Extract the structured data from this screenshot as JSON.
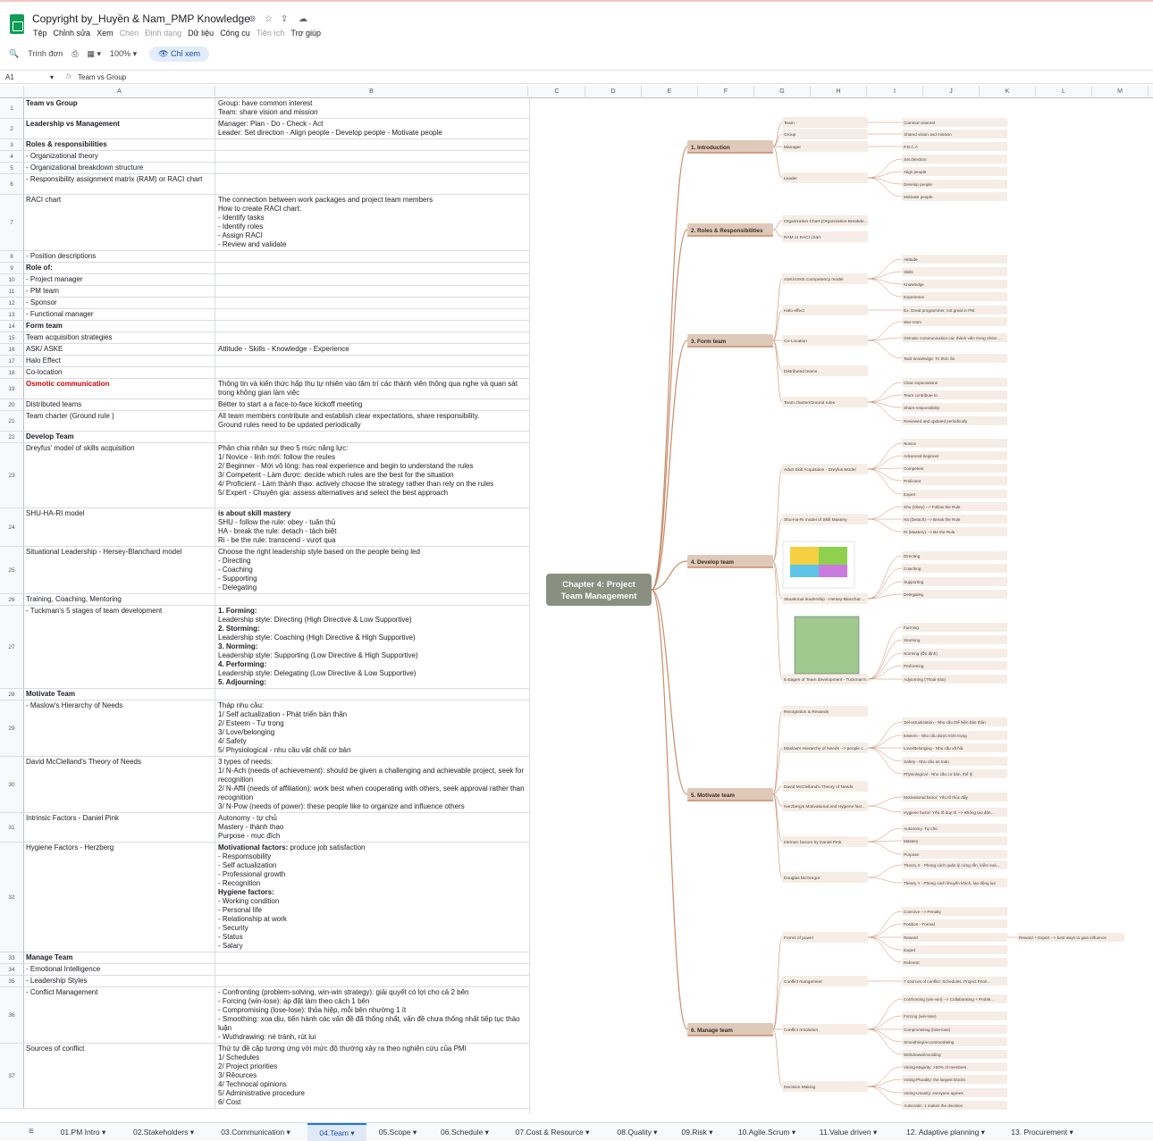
{
  "title": "Copyright by_Huyền & Nam_PMP Knowledge",
  "menus": [
    "Tệp",
    "Chỉnh sửa",
    "Xem",
    "Chèn",
    "Định dạng",
    "Dữ liệu",
    "Công cụ",
    "Tiện ích",
    "Trợ giúp"
  ],
  "toolbar": {
    "search": "Trình đơn",
    "zoom": "100%",
    "viewonly": "Chỉ xem"
  },
  "formula": {
    "cell": "A1",
    "value": "Team vs Group"
  },
  "columns": [
    "A",
    "B",
    "C",
    "D",
    "E",
    "F",
    "G",
    "H",
    "I",
    "J",
    "K",
    "L",
    "M"
  ],
  "rows": [
    {
      "n": "1",
      "a": "Team vs Group",
      "ab": true,
      "b": "Group: have common interest\nTeam: share vision and mission"
    },
    {
      "n": "2",
      "a": "Leadership vs Management",
      "ab": true,
      "b": "Manager: Plan - Do - Check - Act\nLeader: Set direction - Align people - Develop people - Motivate people"
    },
    {
      "n": "3",
      "a": "Roles & responsibilities",
      "ab": true,
      "b": ""
    },
    {
      "n": "4",
      "a": "- Organizational theory",
      "b": ""
    },
    {
      "n": "5",
      "a": "- Organizational breakdown structure",
      "b": ""
    },
    {
      "n": "6",
      "a": "- Responsibility assignment matrix (RAM) or RACI chart",
      "b": ""
    },
    {
      "n": "7",
      "a": "RACI chart",
      "b": "The connection between work packages and project team members\nHow to create RACI chart:\n- Identify tasks\n- Identify roles\n- Assign RACI\n- Review and validate"
    },
    {
      "n": "8",
      "a": "- Position descriptions",
      "b": ""
    },
    {
      "n": "9",
      "a": "Role of:",
      "ab": true,
      "b": ""
    },
    {
      "n": "10",
      "a": "- Project manager",
      "b": ""
    },
    {
      "n": "11",
      "a": "- PM team",
      "b": ""
    },
    {
      "n": "12",
      "a": "- Sponsor",
      "b": ""
    },
    {
      "n": "13",
      "a": "- Functional manager",
      "b": ""
    },
    {
      "n": "14",
      "a": "Form team",
      "ab": true,
      "b": ""
    },
    {
      "n": "15",
      "a": "Team acquisition strategies",
      "b": ""
    },
    {
      "n": "16",
      "a": "ASK/ ASKE",
      "b": "Attitude - Skills - Knowledge - Experience"
    },
    {
      "n": "17",
      "a": "Halo Effect",
      "b": ""
    },
    {
      "n": "18",
      "a": "Co-location",
      "b": ""
    },
    {
      "n": "19",
      "a": "Osmotic communication",
      "ab": true,
      "ared": true,
      "b": "Thông tin và kiến thức hấp thụ tự nhiên vào tâm trí các thành viên thông qua nghe và quan sát trong không gian làm việc"
    },
    {
      "n": "20",
      "a": "Distributed teams",
      "b": "Better to start a a face-to-face kickoff meeting"
    },
    {
      "n": "21",
      "a": "Team charter (Ground rule )",
      "b": "All team members contribute and establish clear expectations, share responsibility.\nGround rules need to be updated periodically"
    },
    {
      "n": "22",
      "a": "Develop Team",
      "ab": true,
      "b": ""
    },
    {
      "n": "23",
      "a": "Dreyfus' model of skills acquisition",
      "b": "Phân chia nhân sự theo 5 mức năng lực:\n1/ Novice - linh mới: follow the reules\n2/ Beginner - Mới vô lòng: has real experience and begin to understand the rules\n3/ Competent - Làm được: decide which rules are the best for the situation\n4/ Proficient - Làm thành thạo: actively choose the strategy rather than rely on the rules\n5/ Expert - Chuyên gia: assess alternatives and select the best approach"
    },
    {
      "n": "24",
      "a": "SHU-HA-RI model",
      "b": "is about skill mastery\nSHU - follow the rule: obey - tuân thủ\nHA - break the rule: detach - tách biệt\nRi - be the rule: transcend - vượt qua"
    },
    {
      "n": "25",
      "a": "Situational Leadership - Hersey-Blanchard model",
      "b": "Choose the right leadership style based on the people being led\n- Directing\n- Coaching\n- Supporting\n- Delegating"
    },
    {
      "n": "26",
      "a": "Training, Coaching, Mentoring",
      "b": ""
    },
    {
      "n": "27",
      "a": "- Tuckman's 5 stages of team development",
      "b": "1. Forming:\nLeadership style: Directing (High Directive & Low Supportive)\n2. Storming:\nLeadership style: Coaching (High Directive & High Supportive)\n3. Norming:\nLeadership style: Supporting (Low Directive & High Supportive)\n4. Performing:\nLeadership style: Delegating (Low Directive & Low Supportive)\n5. Adjourning:"
    },
    {
      "n": "28",
      "a": "Motivate Team",
      "ab": true,
      "b": ""
    },
    {
      "n": "29",
      "a": "- Maslow's Hierarchy of Needs",
      "b": "Tháp nhu cầu:\n1/ Self actualization - Phát triển bản thân\n2/ Esteem - Tự trọng\n3/ Love/belonging\n4/ Safety\n5/ Physiological - nhu cầu vật chất cơ bản"
    },
    {
      "n": "30",
      "a": "David McClelland's Theory of Needs",
      "b": "3 types of needs:\n1/ N-Ach (needs of achievement): should be given a challenging and achievable project, seek for recognition\n2/ N-Affil (needs of affiliation): work best when cooperating with others, seek approval rather than recognition\n3/ N-Pow (needs of power): these people like to organize and influence others"
    },
    {
      "n": "31",
      "a": "Intrinsic Factors - Daniel Pink",
      "b": "Autonomy - tự chủ\nMastery - thành thạo\nPurpose - mục đích"
    },
    {
      "n": "32",
      "a": "Hygiene Factors - Herzberg",
      "b": "Motivational factors: produce job satisfaction\n- Respomsobility\n- Self actualization\n- Professional growth\n- Recognition\nHygiene factors:\n- Working condition\n- Personal life\n- Relationship at work\n- Security\n- Status\n- Salary"
    },
    {
      "n": "33",
      "a": "Manage Team",
      "ab": true,
      "b": ""
    },
    {
      "n": "34",
      "a": "- Emotional Intelligence",
      "b": ""
    },
    {
      "n": "35",
      "a": "- Leadership Styles",
      "b": ""
    },
    {
      "n": "36",
      "a": "- Conflict Management",
      "b": "- Confronting (problem-solving, win-win strategy): giải quyết có lợi cho cả 2 bên\n- Forcing (win-lose): áp đặt làm theo cách 1 bên\n- Compromising (lose-lose): thỏa hiệp, mỗi bên nhường 1 ít\n- Smoothing: xoa dịu, tiến hành các vấn đề đã thống nhất, vấn đề chưa thống nhất tiếp tục thảo luận\n- Wuthdrawing: né tránh, rút lui"
    },
    {
      "n": "37",
      "a": "Sources of conflict",
      "b": "Thứ tự đề cập tương ứng với mức độ thường xảy ra theo nghiên cứu của PMI\n1/ Schedules\n2/ Project priorities\n3/ Rêources\n4/ Technocal opinions\n5/ Administrative procedure\n6/ Cost\n7/ Personality"
    }
  ],
  "mindmap": {
    "root": "Chapter 4: Project Team Management",
    "branches": [
      {
        "label": "1. Introduction",
        "mids": [
          {
            "label": "Team",
            "leaves": [
              "Common interest"
            ]
          },
          {
            "label": "Group",
            "leaves": [
              "Shared vision and mission"
            ]
          },
          {
            "label": "Manager",
            "leaves": [
              "P.D.C.A"
            ]
          },
          {
            "label": "Leader",
            "leaves": [
              "Set direction",
              "Align people",
              "Develop people",
              "Motivate people"
            ]
          }
        ]
      },
      {
        "label": "2. Roles & Responsibilities",
        "mids": [
          {
            "label": "Organization Chart (Organization Breakdown Structure)",
            "leaves": []
          },
          {
            "label": "RAM or RACI chart",
            "leaves": []
          }
        ]
      },
      {
        "label": "3. Form team",
        "mids": [
          {
            "label": "ASK/ASKE Competency model",
            "leaves": [
              "Attitude",
              "Skills",
              "Knowledge",
              "Experience"
            ]
          },
          {
            "label": "Halo effect",
            "leaves": [
              "Ex. Great programmer, not great in PM."
            ]
          },
          {
            "label": "Co-Location",
            "leaves": [
              "War room",
              "Osmotic communication các thành viên trong nhóm thẩm thấu thông tin",
              "Tacit knowledge: Tri thức ẩn"
            ]
          },
          {
            "label": "Distributed teams",
            "leaves": []
          },
          {
            "label": "Team charter/Ground rules",
            "leaves": [
              "Clear expectations",
              "Team contribute to",
              "Share responsibility",
              "Reviewed and updated periodically"
            ]
          }
        ]
      },
      {
        "label": "4. Develop team",
        "mids": [
          {
            "label": "Adult Skill Acquisition - Dreyfus Model",
            "leaves": [
              "Novice",
              "Advanced beginner",
              "Competent",
              "Proficient",
              "Expert"
            ]
          },
          {
            "label": "Shu-Ha-Ri model of Skill Mastery",
            "leaves": [
              "Shu (Obey) --> Follow the Rule",
              "Ha (Detach) --> Break the Rule",
              "Ri (Mastery) --> Be the Rule"
            ]
          },
          {
            "label": "Situational leadership - Hersey-Blanchard model",
            "leaves": [
              "Directing",
              "Coaching",
              "Supporting",
              "Delegating"
            ]
          },
          {
            "label": "5 stages of Team development - Tuckman's ladder",
            "leaves": [
              "Forming",
              "Storming",
              "Norming (Ổn định)",
              "Performing",
              "Adjourning (Thoái trào)"
            ]
          }
        ]
      },
      {
        "label": "5. Motivate team",
        "mids": [
          {
            "label": "Recognition & Rewards",
            "leaves": []
          },
          {
            "label": "Maslow's Hierarchy of Needs --> people cannot ascend to the next level until the levels below are fulfilled",
            "leaves": [
              "Sel-actualization - Nhu cầu thể hiện bản thân",
              "Esteem - Nhu cầu được kính trọng",
              "Love/Belonging - Nhu cầu xã hội",
              "Safety - Nhu cầu an toàn",
              "Physiological - Nhu cầu cơ bản, thể lý"
            ]
          },
          {
            "label": "David McClelland's Theory of Needs",
            "leaves": []
          },
          {
            "label": "Herzberg's Motivational and Hygiene factors: có 2 nhóm yếu tố tạo động lực làm việc",
            "leaves": [
              "Motivational factor: Yếu tố thúc đẩy",
              "Hygiene factor: Yếu tố duy trì --> Không tạo động lực trực tiếp, nhưng thiếu sẽ gây bất mãn"
            ]
          },
          {
            "label": "Intrinsic factors by Daniel Pink",
            "leaves": [
              "Autonomy: Tự chủ",
              "Mastery",
              "Purpose"
            ]
          },
          {
            "label": "Douglas McGregor",
            "leaves": [
              "Theory X - Phong cách quản lý cứng rắn, kiểm soát",
              "Theory Y - Phong cách khuyến khích, tạo động lực"
            ]
          }
        ]
      },
      {
        "label": "6. Manage team",
        "mids": [
          {
            "label": "Forms of power",
            "leaves": [
              "Coercive --> Penalty",
              "Position - Formal",
              "Reward",
              "Expert",
              "Referent"
            ]
          },
          {
            "label": "Conflict mangement",
            "leaves": [
              "7 sources of conflict: Schedules, Project Priorities, Resources, Technical Opinions, Admin Procedure, Cost, Personality."
            ]
          },
          {
            "label": "Conflict resolution",
            "leaves": [
              "Confronting (win-win) --> Collaborating + Problem solving",
              "Forcing (win-lose)",
              "Compromising (lose-lose)",
              "Smoothing/Accommodating",
              "Withdrawal/Avoiding"
            ]
          },
          {
            "label": "Decision Making",
            "leaves": [
              "Voting-Majority: >50% of members",
              "Voting-Plurality: the largest blocks",
              "Voting-Unanity: everyone agrees",
              "Autocratic: 1 makes the decision"
            ]
          }
        ]
      }
    ],
    "extra": "Reward + Expert --> best ways to gain influence"
  },
  "tabs": [
    "01.PM Intro",
    "02.Stakeholders",
    "03.Communication",
    "04.Team",
    "05.Scope",
    "06.Schedule",
    "07.Cost & Resource",
    "08.Quality",
    "09.Risk",
    "10.Agile.Scrum",
    "11.Value driven",
    "12. Adaptive planning",
    "13. Procurement"
  ],
  "active_tab": "04.Team",
  "colors": {
    "root": "#8a8f80",
    "branch_bg": "#dfc9b8",
    "leaf_bg": "#f6ede6",
    "accent": "#1a73e8",
    "line": "#c98b6b"
  }
}
